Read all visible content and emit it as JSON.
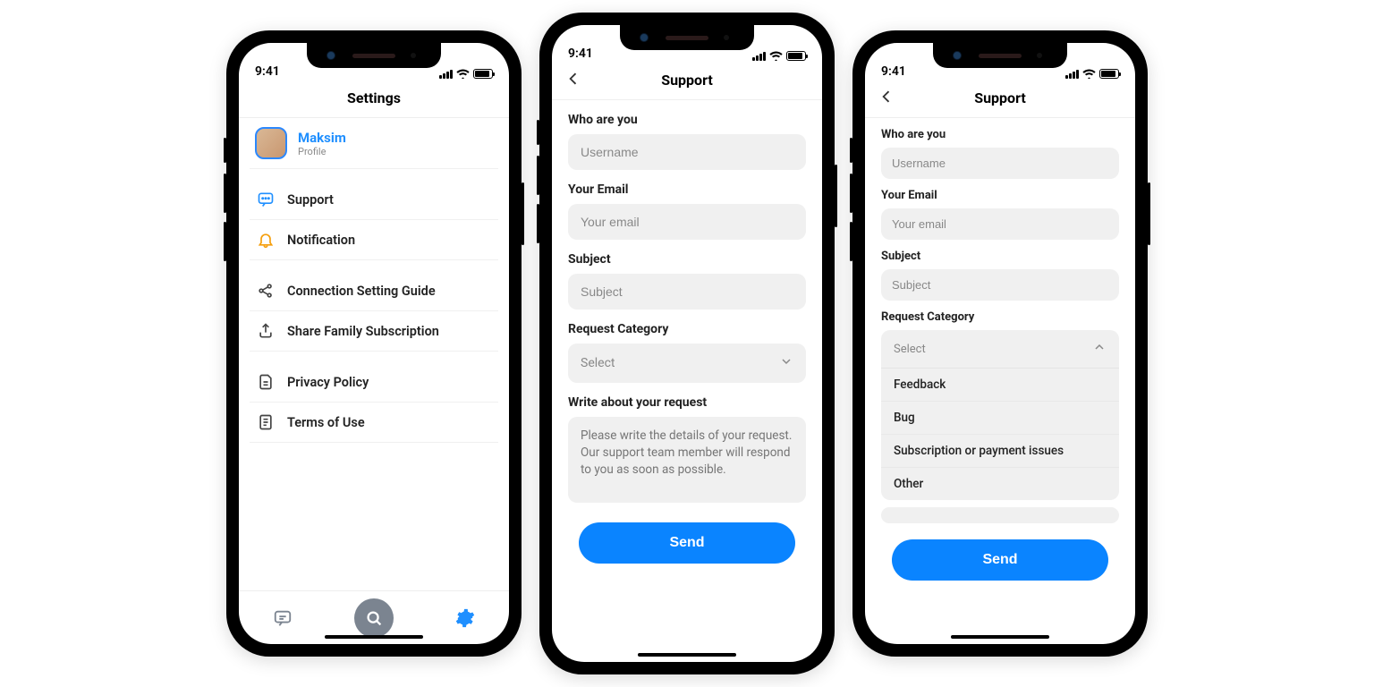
{
  "status": {
    "time": "9:41"
  },
  "settings": {
    "title": "Settings",
    "profile": {
      "name": "Maksim",
      "sub": "Profile"
    },
    "items": {
      "support": "Support",
      "notification": "Notification",
      "guide": "Connection Setting Guide",
      "share": "Share Family Subscription",
      "privacy": "Privacy Policy",
      "terms": "Terms of Use"
    }
  },
  "support": {
    "title": "Support",
    "who_label": "Who are you",
    "who_placeholder": "Username",
    "email_label": "Your Email",
    "email_placeholder": "Your email",
    "subject_label": "Subject",
    "subject_placeholder": "Subject",
    "category_label": "Request Category",
    "category_placeholder": "Select",
    "message_label": "Write about your request",
    "message_placeholder": "Please write the details of your request. Our support team member will respond to you as soon as possible.",
    "send": "Send",
    "options": {
      "feedback": "Feedback",
      "bug": "Bug",
      "payment": "Subscription or payment issues",
      "other": "Other"
    }
  }
}
